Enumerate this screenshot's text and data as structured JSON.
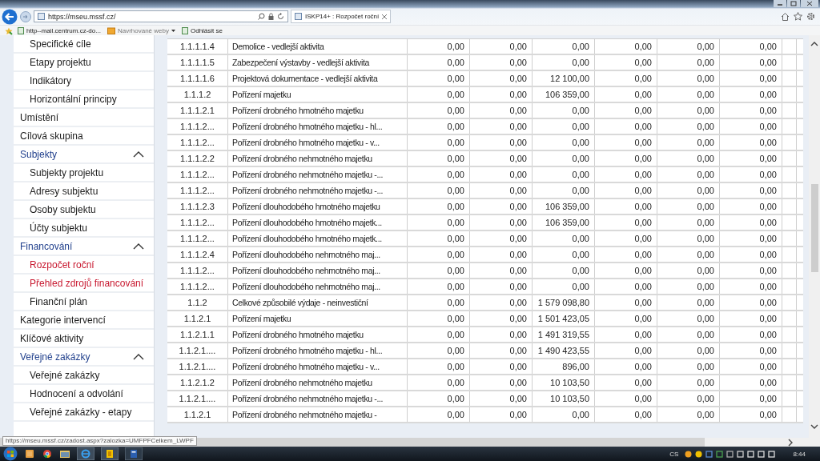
{
  "browser": {
    "address": "https://mseu.mssf.cz/",
    "tab": {
      "title": "ISKP14+ : Rozpočet roční"
    },
    "favorites": [
      {
        "label": "http--mail.centrum.cz-do...",
        "kind": "page"
      },
      {
        "label": "Navrhované weby",
        "kind": "folder"
      },
      {
        "label": "Odhlásit se",
        "kind": "page"
      }
    ],
    "status_url": "https://mseu.mssf.cz/zadost.aspx?zalozka=UMFPFCelkem_LWPF"
  },
  "sidebar": {
    "items": [
      {
        "label": "Specifické cíle",
        "kind": "subitem",
        "current": false
      },
      {
        "label": "Etapy projektu",
        "kind": "subitem",
        "current": false
      },
      {
        "label": "Indikátory",
        "kind": "subitem",
        "current": false
      },
      {
        "label": "Horizontální principy",
        "kind": "subitem",
        "current": false
      },
      {
        "label": "Umístění",
        "kind": "item",
        "current": false
      },
      {
        "label": "Cílová skupina",
        "kind": "item",
        "current": false
      },
      {
        "label": "Subjekty",
        "kind": "section",
        "expanded": true,
        "current": false
      },
      {
        "label": "Subjekty projektu",
        "kind": "subitem",
        "current": false
      },
      {
        "label": "Adresy subjektu",
        "kind": "subitem",
        "current": false
      },
      {
        "label": "Osoby subjektu",
        "kind": "subitem",
        "current": false
      },
      {
        "label": "Účty subjektu",
        "kind": "subitem",
        "current": false
      },
      {
        "label": "Financování",
        "kind": "section",
        "expanded": true,
        "current": false
      },
      {
        "label": "Rozpočet roční",
        "kind": "subitem",
        "current": true
      },
      {
        "label": "Přehled zdrojů financování",
        "kind": "subitem",
        "current": true
      },
      {
        "label": "Finanční plán",
        "kind": "subitem",
        "current": false
      },
      {
        "label": "Kategorie intervencí",
        "kind": "item",
        "current": false
      },
      {
        "label": "Klíčové aktivity",
        "kind": "item",
        "current": false
      },
      {
        "label": "Veřejné zakázky",
        "kind": "section",
        "expanded": true,
        "current": false
      },
      {
        "label": "Veřejné zakázky",
        "kind": "subitem",
        "current": false
      },
      {
        "label": "Hodnocení a odvolání",
        "kind": "subitem",
        "current": false
      },
      {
        "label": "Veřejné zakázky - etapy",
        "kind": "subitem",
        "current": false
      }
    ]
  },
  "table": {
    "rows": [
      {
        "code": "1.1.1.1.4",
        "name": "Demolice - vedlejší aktivita",
        "values": [
          "0,00",
          "0,00",
          "0,00",
          "0,00",
          "0,00",
          "0,00"
        ]
      },
      {
        "code": "1.1.1.1.5",
        "name": "Zabezpečení výstavby - vedlejší aktivita",
        "values": [
          "0,00",
          "0,00",
          "0,00",
          "0,00",
          "0,00",
          "0,00"
        ]
      },
      {
        "code": "1.1.1.1.6",
        "name": "Projektová dokumentace - vedlejší aktivita",
        "values": [
          "0,00",
          "0,00",
          "12 100,00",
          "0,00",
          "0,00",
          "0,00"
        ]
      },
      {
        "code": "1.1.1.2",
        "name": "Pořízení majetku",
        "values": [
          "0,00",
          "0,00",
          "106 359,00",
          "0,00",
          "0,00",
          "0,00"
        ]
      },
      {
        "code": "1.1.1.2.1",
        "name": "Pořízení drobného hmotného majetku",
        "values": [
          "0,00",
          "0,00",
          "0,00",
          "0,00",
          "0,00",
          "0,00"
        ]
      },
      {
        "code": "1.1.1.2...",
        "name": "Pořízení drobného hmotného majetku - hl...",
        "values": [
          "0,00",
          "0,00",
          "0,00",
          "0,00",
          "0,00",
          "0,00"
        ]
      },
      {
        "code": "1.1.1.2...",
        "name": "Pořízení drobného hmotného majetku - v...",
        "values": [
          "0,00",
          "0,00",
          "0,00",
          "0,00",
          "0,00",
          "0,00"
        ]
      },
      {
        "code": "1.1.1.2.2",
        "name": "Pořízení drobného nehmotného majetku",
        "values": [
          "0,00",
          "0,00",
          "0,00",
          "0,00",
          "0,00",
          "0,00"
        ]
      },
      {
        "code": "1.1.1.2...",
        "name": "Pořízení drobného nehmotného majetku -...",
        "values": [
          "0,00",
          "0,00",
          "0,00",
          "0,00",
          "0,00",
          "0,00"
        ]
      },
      {
        "code": "1.1.1.2...",
        "name": "Pořízení drobného nehmotného majetku -...",
        "values": [
          "0,00",
          "0,00",
          "0,00",
          "0,00",
          "0,00",
          "0,00"
        ]
      },
      {
        "code": "1.1.1.2.3",
        "name": "Pořízení dlouhodobého hmotného majetku",
        "values": [
          "0,00",
          "0,00",
          "106 359,00",
          "0,00",
          "0,00",
          "0,00"
        ]
      },
      {
        "code": "1.1.1.2...",
        "name": "Pořízení dlouhodobého hmotného majetk...",
        "values": [
          "0,00",
          "0,00",
          "106 359,00",
          "0,00",
          "0,00",
          "0,00"
        ]
      },
      {
        "code": "1.1.1.2...",
        "name": "Pořízení dlouhodobého hmotného majetk...",
        "values": [
          "0,00",
          "0,00",
          "0,00",
          "0,00",
          "0,00",
          "0,00"
        ]
      },
      {
        "code": "1.1.1.2.4",
        "name": "Pořízení dlouhodobého nehmotného maj...",
        "values": [
          "0,00",
          "0,00",
          "0,00",
          "0,00",
          "0,00",
          "0,00"
        ]
      },
      {
        "code": "1.1.1.2...",
        "name": "Pořízení dlouhodobého nehmotného maj...",
        "values": [
          "0,00",
          "0,00",
          "0,00",
          "0,00",
          "0,00",
          "0,00"
        ]
      },
      {
        "code": "1.1.1.2...",
        "name": "Pořízení dlouhodobého nehmotného maj...",
        "values": [
          "0,00",
          "0,00",
          "0,00",
          "0,00",
          "0,00",
          "0,00"
        ]
      },
      {
        "code": "1.1.2",
        "name": "Celkové způsobilé výdaje - neinvestiční",
        "values": [
          "0,00",
          "0,00",
          "1 579 098,80",
          "0,00",
          "0,00",
          "0,00"
        ]
      },
      {
        "code": "1.1.2.1",
        "name": "Pořízení majetku",
        "values": [
          "0,00",
          "0,00",
          "1 501 423,05",
          "0,00",
          "0,00",
          "0,00"
        ]
      },
      {
        "code": "1.1.2.1.1",
        "name": "Pořízení drobného hmotného majetku",
        "values": [
          "0,00",
          "0,00",
          "1 491 319,55",
          "0,00",
          "0,00",
          "0,00"
        ]
      },
      {
        "code": "1.1.2.1....",
        "name": "Pořízení drobného hmotného majetku - hl...",
        "values": [
          "0,00",
          "0,00",
          "1 490 423,55",
          "0,00",
          "0,00",
          "0,00"
        ]
      },
      {
        "code": "1.1.2.1....",
        "name": "Pořízení drobného hmotného majetku - v...",
        "values": [
          "0,00",
          "0,00",
          "896,00",
          "0,00",
          "0,00",
          "0,00"
        ]
      },
      {
        "code": "1.1.2.1.2",
        "name": "Pořízení drobného nehmotného majetku",
        "values": [
          "0,00",
          "0,00",
          "10 103,50",
          "0,00",
          "0,00",
          "0,00"
        ]
      },
      {
        "code": "1.1.2.1....",
        "name": "Pořízení drobného nehmotného majetku -...",
        "values": [
          "0,00",
          "0,00",
          "10 103,50",
          "0,00",
          "0,00",
          "0,00"
        ]
      },
      {
        "code": "1.1.2.1",
        "name": "Pořízení drobného nehmotného majetku -",
        "values": [
          "0,00",
          "0,00",
          "0,00",
          "0,00",
          "0,00",
          "0,00"
        ]
      }
    ]
  },
  "taskbar": {
    "language": "CS",
    "clock": "8:44"
  }
}
